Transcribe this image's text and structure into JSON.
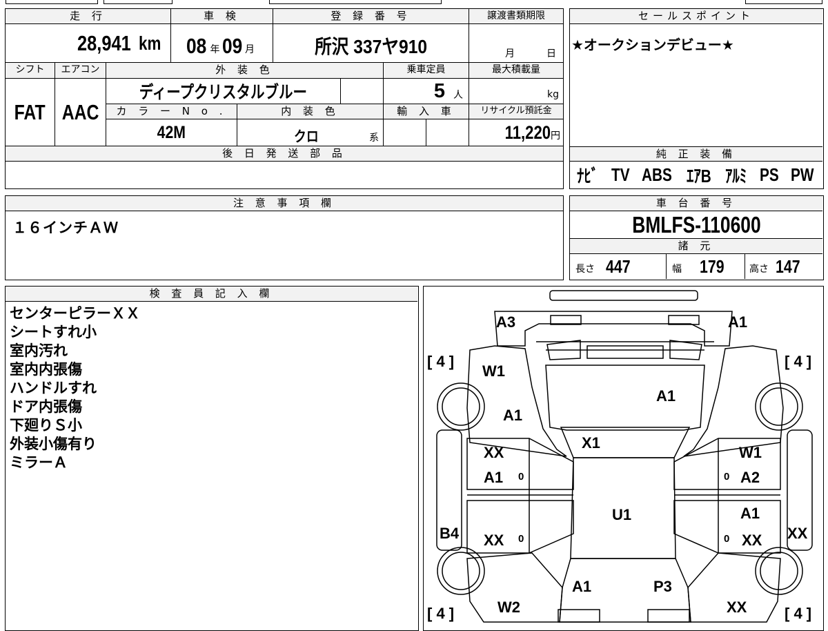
{
  "labels": {
    "mileage": "走 行",
    "inspection": "車 検",
    "registration": "登 録 番 号",
    "transfer_deadline": "譲渡書類期限",
    "sales_point": "セールスポイント",
    "shift": "シフト",
    "aircon": "エアコン",
    "exterior_color": "外 装 色",
    "capacity": "乗車定員",
    "max_load": "最大積載量",
    "color_no": "カ ラ ー N o .",
    "interior_color": "内 装 色",
    "import": "輸 入 車",
    "recycle_fee": "リサイクル預託金",
    "later_parts": "後 日 発 送 部 品",
    "genuine_equipment": "純 正 装 備",
    "caution": "注 意 事 項 欄",
    "chassis_no": "車 台 番 号",
    "specs": "諸 元",
    "inspector_notes": "検 査 員 記 入 欄"
  },
  "vehicle": {
    "mileage_value": "28,941",
    "mileage_unit": "km",
    "inspection_year": "08",
    "year_unit": "年",
    "inspection_month": "09",
    "month_unit": "月",
    "registration_number": "所沢 337ヤ910",
    "transfer_month_unit": "月",
    "transfer_day_unit": "日",
    "shift_value": "FAT",
    "aircon_value": "AAC",
    "exterior_color_value": "ディープクリスタルブルー",
    "capacity_value": "5",
    "capacity_unit": "人",
    "max_load_unit": "kg",
    "color_no_value": "42M",
    "interior_color_value": "クロ",
    "interior_color_unit": "系",
    "recycle_fee_value": "11,220",
    "recycle_fee_unit": "円",
    "chassis_number": "BMLFS-110600",
    "length_label": "長さ",
    "length_value": "447",
    "width_label": "幅",
    "width_value": "179",
    "height_label": "高さ",
    "height_value": "147"
  },
  "sales_point_text": "★オークションデビュー★",
  "equipment": [
    "ﾅﾋﾞ",
    "TV",
    "ABS",
    "ｴｱB",
    "ｱﾙﾐ",
    "PS",
    "PW"
  ],
  "caution_text": "１６インチＡＷ",
  "inspector_notes": [
    "センターピラーＸＸ",
    "シートすれ小",
    "室内汚れ",
    "室内内張傷",
    "ハンドルすれ",
    "ドア内張傷",
    "下廻りＳ小",
    "外装小傷有り",
    "ミラーＡ"
  ],
  "diagram": {
    "tire_fl": "[ 4 ]",
    "tire_fr": "[ 4 ]",
    "tire_rl": "[ 4 ]",
    "tire_rr": "[ 4 ]",
    "bumper_left": "A3",
    "bumper_right": "A1",
    "fender_left_a": "W1",
    "fender_left_b": "A1",
    "hood": "A1",
    "windshield": "X1",
    "front_door_left_a": "XX",
    "front_door_left_b": "A1",
    "front_door_right_a": "W1",
    "front_door_right_b": "A2",
    "roof": "U1",
    "rear_door_left": "XX",
    "rear_door_right_a": "A1",
    "rear_door_right_b": "XX",
    "sill_left": "B4",
    "sill_right": "XX",
    "trunk_left": "A1",
    "trunk_right": "P3",
    "rear_fender_left": "W2",
    "rear_fender_right": "XX",
    "door_mark": "0"
  }
}
